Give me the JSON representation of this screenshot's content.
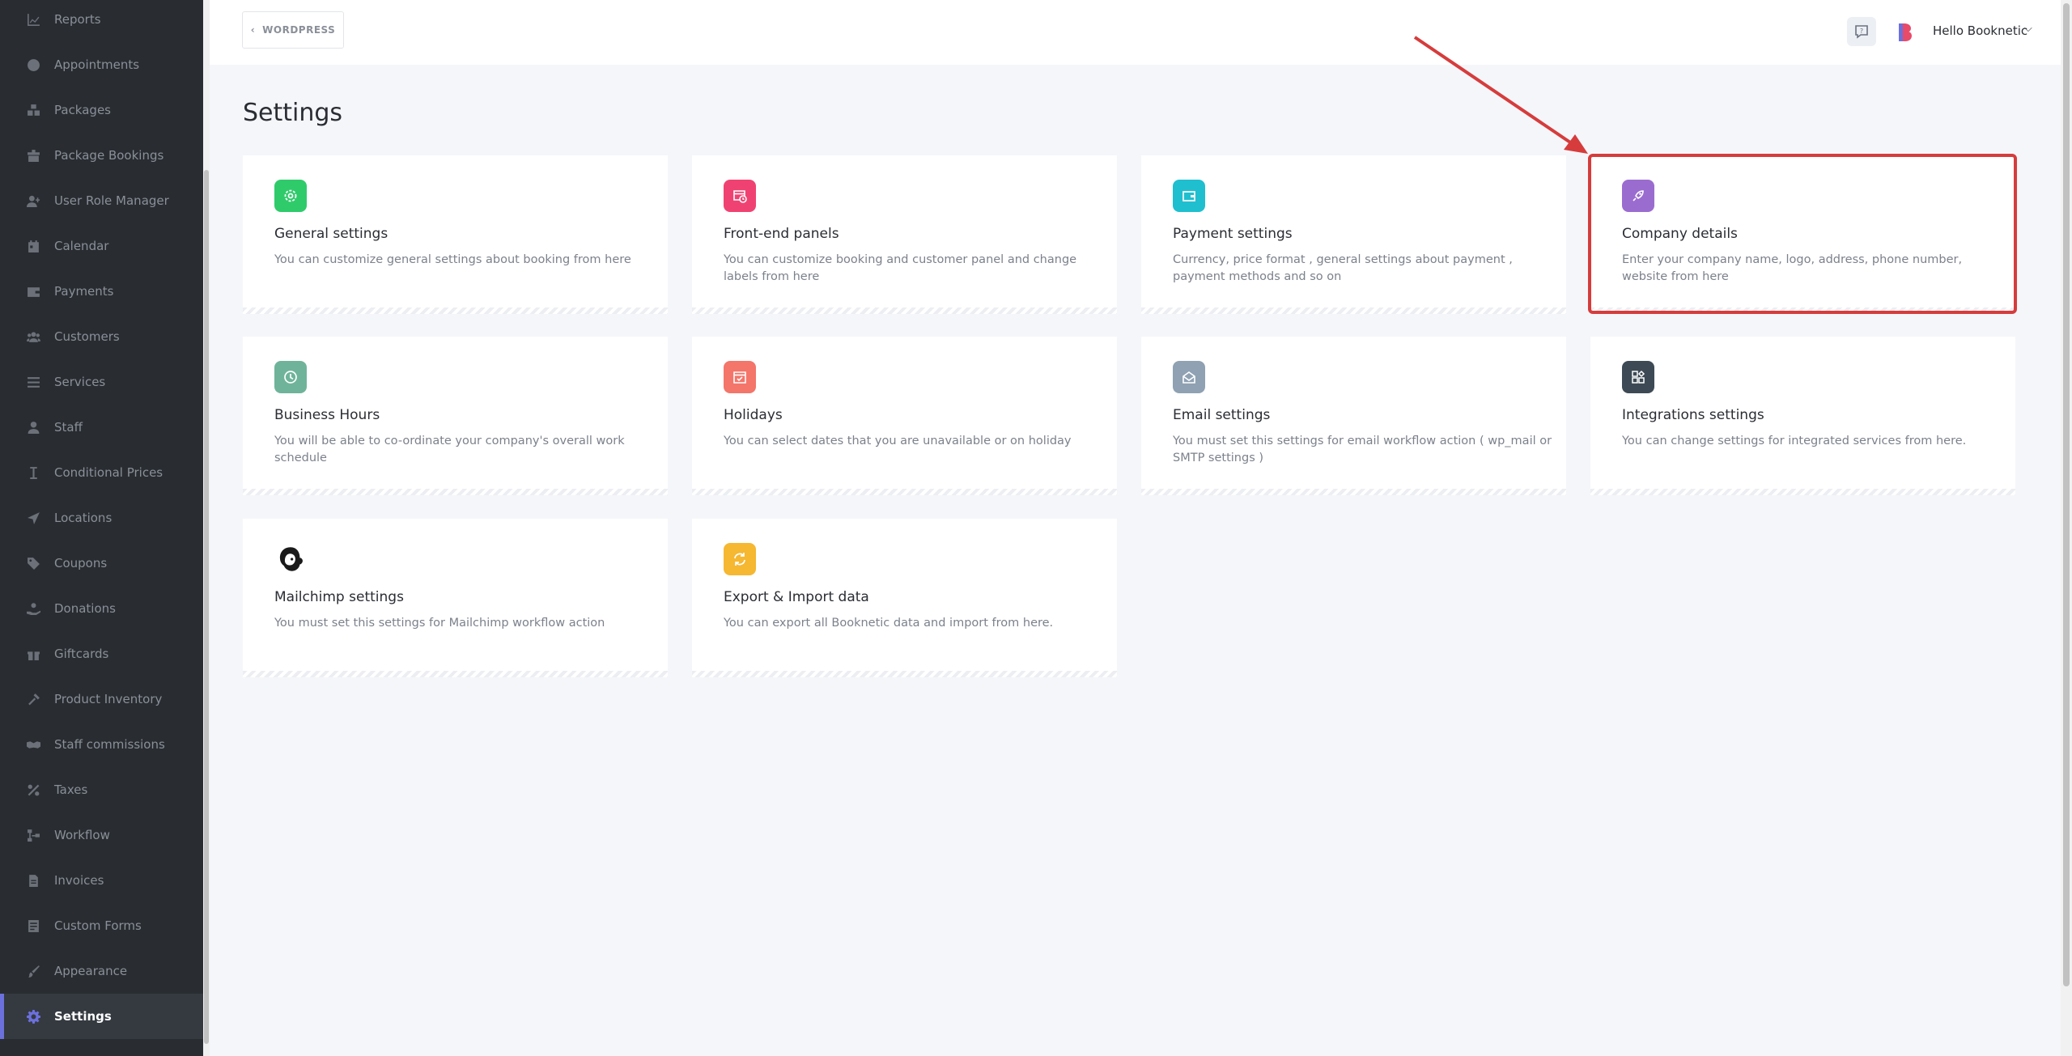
{
  "sidebar": {
    "items": [
      {
        "label": "Reports",
        "icon": "chart-icon"
      },
      {
        "label": "Appointments",
        "icon": "clock-icon"
      },
      {
        "label": "Packages",
        "icon": "boxes-icon"
      },
      {
        "label": "Package Bookings",
        "icon": "package-bookings-icon"
      },
      {
        "label": "User Role Manager",
        "icon": "user-role-icon"
      },
      {
        "label": "Calendar",
        "icon": "calendar-icon"
      },
      {
        "label": "Payments",
        "icon": "wallet-icon"
      },
      {
        "label": "Customers",
        "icon": "users-icon"
      },
      {
        "label": "Services",
        "icon": "list-icon"
      },
      {
        "label": "Staff",
        "icon": "user-icon"
      },
      {
        "label": "Conditional Prices",
        "icon": "text-cursor-icon"
      },
      {
        "label": "Locations",
        "icon": "location-arrow-icon"
      },
      {
        "label": "Coupons",
        "icon": "tags-icon"
      },
      {
        "label": "Donations",
        "icon": "hand-holding-icon"
      },
      {
        "label": "Giftcards",
        "icon": "gift-icon"
      },
      {
        "label": "Product Inventory",
        "icon": "tools-icon"
      },
      {
        "label": "Staff commissions",
        "icon": "handshake-icon"
      },
      {
        "label": "Taxes",
        "icon": "percent-icon"
      },
      {
        "label": "Workflow",
        "icon": "workflow-icon"
      },
      {
        "label": "Invoices",
        "icon": "invoice-icon"
      },
      {
        "label": "Custom Forms",
        "icon": "form-icon"
      },
      {
        "label": "Appearance",
        "icon": "brush-icon"
      },
      {
        "label": "Settings",
        "icon": "gear-icon",
        "active": true
      }
    ]
  },
  "header": {
    "back_label": "WORDPRESS",
    "user_name": "Hello Booknetic"
  },
  "page": {
    "title": "Settings"
  },
  "cards": [
    {
      "title": "General settings",
      "desc": "You can customize general settings about booking from here",
      "icon": "gear-icon",
      "color": "#2fcb6b"
    },
    {
      "title": "Front-end panels",
      "desc": "You can customize booking and customer panel and change labels from here",
      "icon": "calendar-clock-icon",
      "color": "#f04272"
    },
    {
      "title": "Payment settings",
      "desc": "Currency, price format , general settings about payment , payment methods and so on",
      "icon": "wallet-icon",
      "color": "#1fbfcf"
    },
    {
      "title": "Company details",
      "desc": "Enter your company name, logo, address, phone number, website from here",
      "icon": "rocket-icon",
      "color": "#9b6cd0"
    },
    {
      "title": "Business Hours",
      "desc": "You will be able to co-ordinate your company's overall work schedule",
      "icon": "clock-icon",
      "color": "#6fb49a"
    },
    {
      "title": "Holidays",
      "desc": "You can select dates that you are unavailable or on holiday",
      "icon": "calendar-check-icon",
      "color": "#f4756a"
    },
    {
      "title": "Email settings",
      "desc": "You must set this settings for email workflow action ( wp_mail or SMTP settings )",
      "icon": "envelope-open-icon",
      "color": "#8fa1b3"
    },
    {
      "title": "Integrations settings",
      "desc": "You can change settings for integrated services from here.",
      "icon": "apps-icon",
      "color": "#3d4a55"
    },
    {
      "title": "Mailchimp settings",
      "desc": "You must set this settings for Mailchimp workflow action",
      "icon": "mailchimp-icon",
      "color": "#ffffff"
    },
    {
      "title": "Export & Import data",
      "desc": "You can export all Booknetic data and import from here.",
      "icon": "sync-icon",
      "color": "#f6b731"
    }
  ],
  "annotation": {
    "highlight_color": "#d63c3c"
  }
}
